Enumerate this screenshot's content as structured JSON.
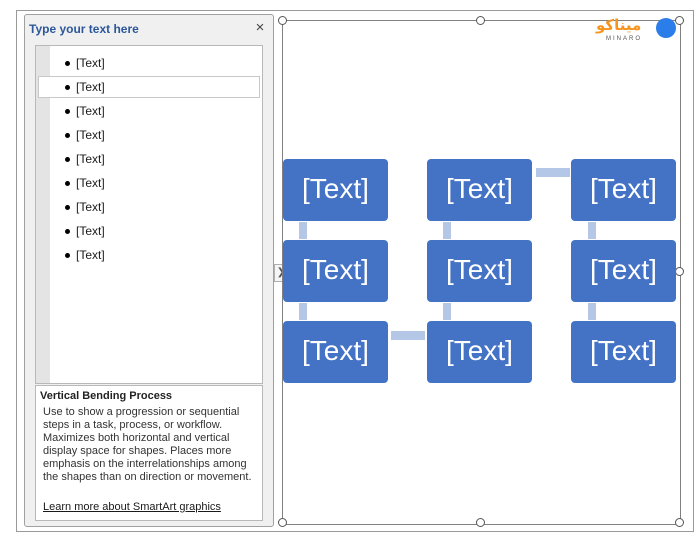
{
  "text_pane": {
    "title": "Type your text here",
    "close_glyph": "×",
    "bullets": [
      "[Text]",
      "[Text]",
      "[Text]",
      "[Text]",
      "[Text]",
      "[Text]",
      "[Text]",
      "[Text]",
      "[Text]"
    ],
    "selected_index": 1,
    "toggle_glyph": "❯"
  },
  "description": {
    "title": "Vertical Bending Process",
    "body": "Use to show a progression or sequential steps in a task, process, or workflow. Maximizes both horizontal and vertical display space for shapes. Places more emphasis on the interrelationships among the shapes than on direction or movement.",
    "link": "Learn more about SmartArt graphics"
  },
  "smartart": {
    "nodes": [
      "[Text]",
      "[Text]",
      "[Text]",
      "[Text]",
      "[Text]",
      "[Text]",
      "[Text]",
      "[Text]",
      "[Text]"
    ],
    "node_color": "#4472c4",
    "connector_color": "#b4c7e7"
  },
  "watermark": {
    "word": "میناکو",
    "sub": "MINARO"
  }
}
